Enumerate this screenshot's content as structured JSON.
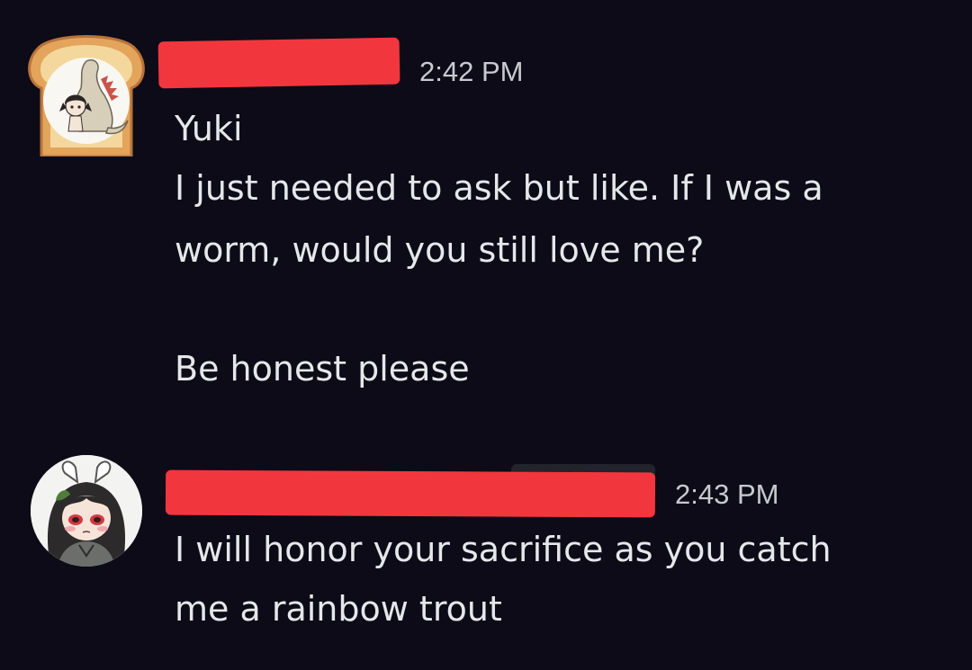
{
  "messages": [
    {
      "timestamp": "2:42 PM",
      "lines": [
        "Yuki",
        "I just needed to ask but like. If I was a",
        "worm, would you still love me?",
        "",
        "Be honest please"
      ]
    },
    {
      "timestamp": "2:43 PM",
      "lines": [
        "I will honor your sacrifice as you catch",
        "me a rainbow trout"
      ]
    }
  ],
  "colors": {
    "background": "#0c0b17",
    "text": "#e6e7ea",
    "timestamp": "#c9cad0",
    "redaction": "#f2363d"
  },
  "icons": {
    "avatar_1": "toast-frame-dinosaur-avatar",
    "avatar_2": "anime-girl-bunny-ears-avatar"
  }
}
